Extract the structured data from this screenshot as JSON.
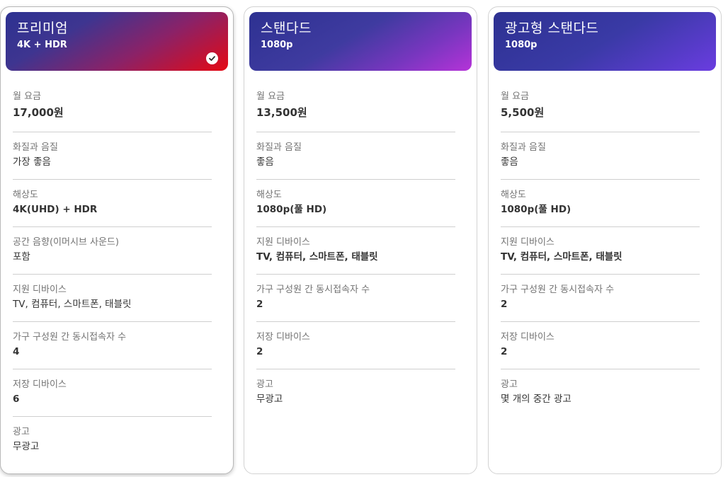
{
  "plans": [
    {
      "name": "프리미엄",
      "resolution": "4K + HDR",
      "selected": true,
      "rows": [
        {
          "label": "월 요금",
          "value": "17,000원"
        },
        {
          "label": "화질과 음질",
          "value": "가장 좋음"
        },
        {
          "label": "해상도",
          "value": "4K(UHD) + HDR"
        },
        {
          "label": "공간 음향(이머시브 사운드)",
          "value": "포함"
        },
        {
          "label": "지원 디바이스",
          "value": "TV, 컴퓨터, 스마트폰, 태블릿"
        },
        {
          "label": "가구 구성원 간 동시접속자 수",
          "value": "4"
        },
        {
          "label": "저장 디바이스",
          "value": "6"
        },
        {
          "label": "광고",
          "value": "무광고"
        }
      ]
    },
    {
      "name": "스탠다드",
      "resolution": "1080p",
      "selected": false,
      "rows": [
        {
          "label": "월 요금",
          "value": "13,500원"
        },
        {
          "label": "화질과 음질",
          "value": "좋음"
        },
        {
          "label": "해상도",
          "value": "1080p(풀 HD)"
        },
        {
          "label": "지원 디바이스",
          "value": "TV, 컴퓨터, 스마트폰, 태블릿"
        },
        {
          "label": "가구 구성원 간 동시접속자 수",
          "value": "2"
        },
        {
          "label": "저장 디바이스",
          "value": "2"
        },
        {
          "label": "광고",
          "value": "무광고"
        }
      ]
    },
    {
      "name": "광고형 스탠다드",
      "resolution": "1080p",
      "selected": false,
      "rows": [
        {
          "label": "월 요금",
          "value": "5,500원"
        },
        {
          "label": "화질과 음질",
          "value": "좋음"
        },
        {
          "label": "해상도",
          "value": "1080p(풀 HD)"
        },
        {
          "label": "지원 디바이스",
          "value": "TV, 컴퓨터, 스마트폰, 태블릿"
        },
        {
          "label": "가구 구성원 간 동시접속자 수",
          "value": "2"
        },
        {
          "label": "저장 디바이스",
          "value": "2"
        },
        {
          "label": "광고",
          "value": "몇 개의 중간 광고"
        }
      ]
    }
  ],
  "icons": {
    "selected_check": "check-circle-icon"
  },
  "colors": {
    "premium_accent": "#e50914",
    "standard_accent": "#b533d8",
    "ads_accent": "#6a3ce0",
    "header_base": "#2d3191"
  }
}
